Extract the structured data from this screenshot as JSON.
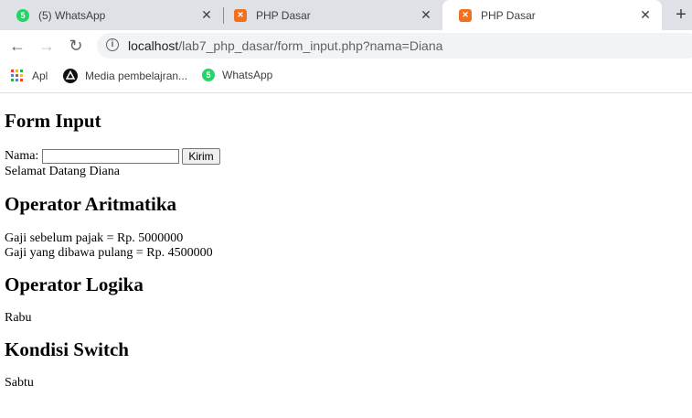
{
  "tabs": [
    {
      "title": "(5) WhatsApp",
      "favicon": "whatsapp-icon",
      "favicon_glyph": "5",
      "favicon_color": "#25d366",
      "active": false
    },
    {
      "title": "PHP Dasar",
      "favicon": "xampp-icon",
      "favicon_glyph": "✕",
      "favicon_color": "#f37021",
      "active": false
    },
    {
      "title": "PHP Dasar",
      "favicon": "xampp-icon",
      "favicon_glyph": "✕",
      "favicon_color": "#f37021",
      "active": true
    }
  ],
  "close_glyph": "✕",
  "new_tab_glyph": "+",
  "toolbar": {
    "back_glyph": "←",
    "forward_glyph": "→",
    "reload_glyph": "↻",
    "info_glyph": "i",
    "url_host": "localhost",
    "url_path": "/lab7_php_dasar/form_input.php?nama=Diana"
  },
  "bookmarks": [
    {
      "label": "Apl",
      "icon": "apps-grid-icon"
    },
    {
      "label": "Media pembelajran...",
      "icon": "media-icon"
    },
    {
      "label": "WhatsApp",
      "icon": "whatsapp-icon",
      "glyph": "5"
    }
  ],
  "page": {
    "form_title": "Form Input",
    "name_label": "Nama:",
    "name_value": "",
    "submit_label": "Kirim",
    "greeting": "Selamat Datang Diana",
    "arith_title": "Operator Aritmatika",
    "gaji_sebelum": "Gaji sebelum pajak = Rp. 5000000",
    "gaji_pulang": "Gaji yang dibawa pulang = Rp. 4500000",
    "logic_title": "Operator Logika",
    "logic_result": "Rabu",
    "switch_title": "Kondisi Switch",
    "switch_result": "Sabtu"
  }
}
